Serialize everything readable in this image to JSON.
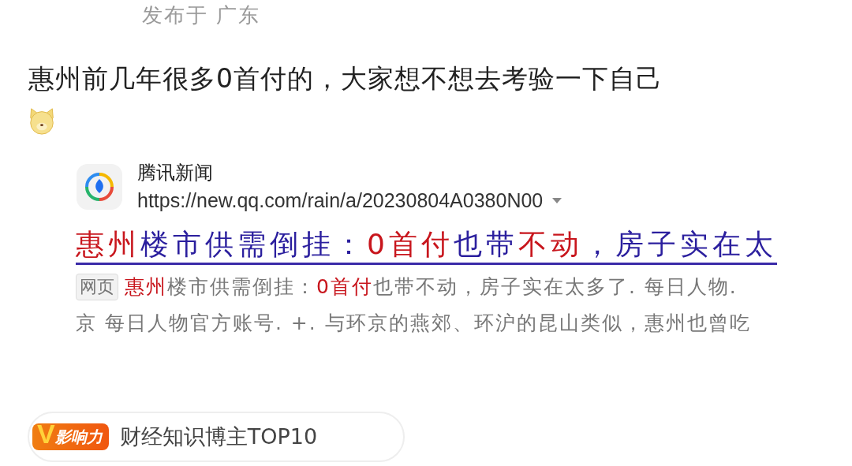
{
  "post_meta": "发布于 广东",
  "post_text": "惠州前几年很多0首付的，大家想不想去考验一下自己",
  "shared_result": {
    "site_name": "腾讯新闻",
    "url": "https://new.qq.com/rain/a/20230804A0380N00",
    "headline": [
      {
        "text": "惠州",
        "highlight": true
      },
      {
        "text": "楼市供需倒挂：",
        "highlight": false
      },
      {
        "text": "0首付",
        "highlight": true
      },
      {
        "text": "也带",
        "highlight": false
      },
      {
        "text": "不动",
        "highlight": true
      },
      {
        "text": "，房子实在太",
        "highlight": false
      }
    ],
    "tag": "网页",
    "snippet_line_1": [
      {
        "text": "惠州",
        "highlight": true
      },
      {
        "text": "楼市供需倒挂：",
        "highlight": false
      },
      {
        "text": "0首付",
        "highlight": true
      },
      {
        "text": "也带不动，房子实在太多了. 每日人物.",
        "highlight": false
      }
    ],
    "snippet_line_2": "京 每日人物官方账号. +. 与环京的燕郊、环沪的昆山类似，惠州也曾吃"
  },
  "influence_badge": {
    "letter": "V",
    "label": "影响力",
    "title": "财经知识博主TOP10"
  }
}
